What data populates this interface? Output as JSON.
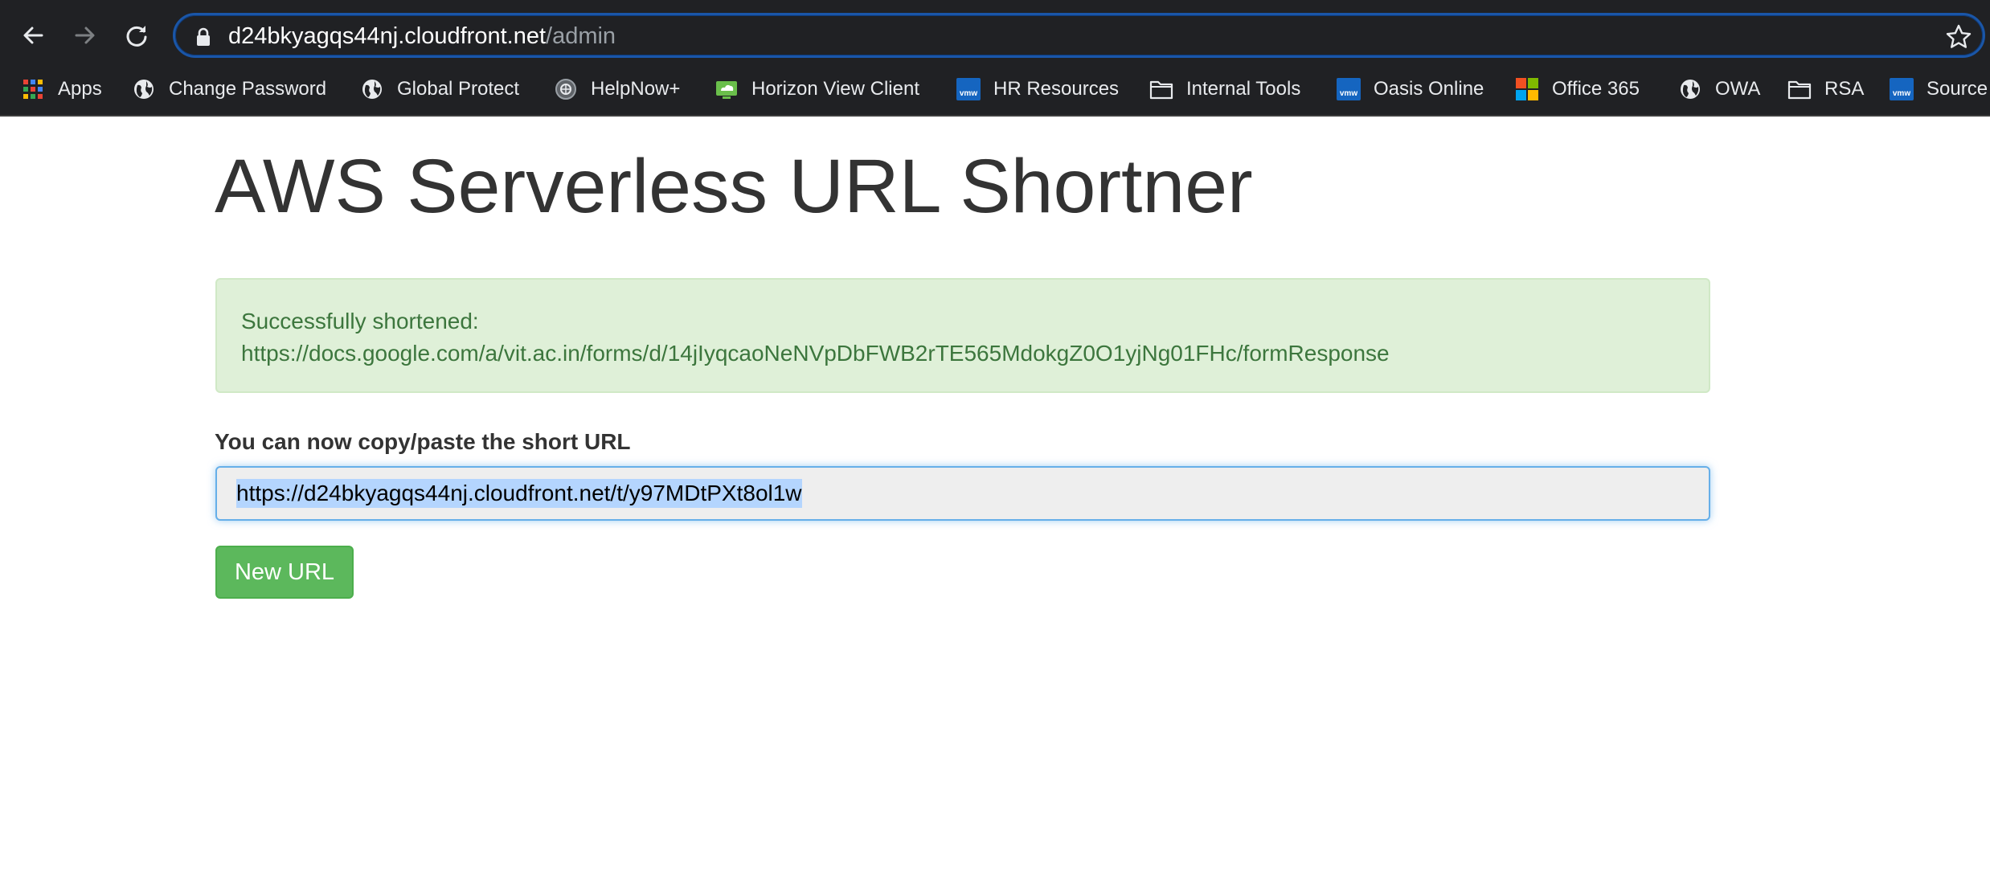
{
  "browser": {
    "url_host": "d24bkyagqs44nj.cloudfront.net",
    "url_path": "/admin",
    "nav": {
      "back_icon": "arrow-left-icon",
      "forward_icon": "arrow-right-icon",
      "reload_icon": "reload-icon",
      "lock_icon": "lock-icon",
      "bookmark_star_icon": "star-icon"
    },
    "bookmarks": [
      {
        "label": "Apps",
        "icon": "apps-grid-icon"
      },
      {
        "label": "Change Password",
        "icon": "globe-icon"
      },
      {
        "label": "Global Protect",
        "icon": "globe-icon"
      },
      {
        "label": "HelpNow+",
        "icon": "helpnow-icon"
      },
      {
        "label": "Horizon View Client",
        "icon": "horizon-cloud-icon"
      },
      {
        "label": "HR Resources",
        "icon": "vmw-icon"
      },
      {
        "label": "Internal Tools",
        "icon": "folder-icon"
      },
      {
        "label": "Oasis Online",
        "icon": "vmw-icon"
      },
      {
        "label": "Office 365",
        "icon": "microsoft-icon"
      },
      {
        "label": "OWA",
        "icon": "globe-icon"
      },
      {
        "label": "RSA",
        "icon": "folder-icon"
      },
      {
        "label": "Source",
        "icon": "vmw-icon"
      }
    ],
    "vmw_badge": "vmw"
  },
  "page": {
    "title": "AWS Serverless URL Shortner",
    "alert": {
      "line1": "Successfully shortened:",
      "line2": "https://docs.google.com/a/vit.ac.in/forms/d/14jIyqcaoNeNVpDbFWB2rTE565MdokgZ0O1yjNg01FHc/formResponse"
    },
    "short_url_label": "You can now copy/paste the short URL",
    "short_url_value": "https://d24bkyagqs44nj.cloudfront.net/t/y97MDtPXt8ol1w",
    "new_url_button": "New URL"
  },
  "colors": {
    "chrome_bg": "#202124",
    "omnibox_border": "#1a56a8",
    "alert_bg": "#dff0d8",
    "alert_text": "#3c763d",
    "button_bg": "#5cb85c",
    "input_focus": "#66afe9",
    "selection": "#b4d5fe"
  }
}
